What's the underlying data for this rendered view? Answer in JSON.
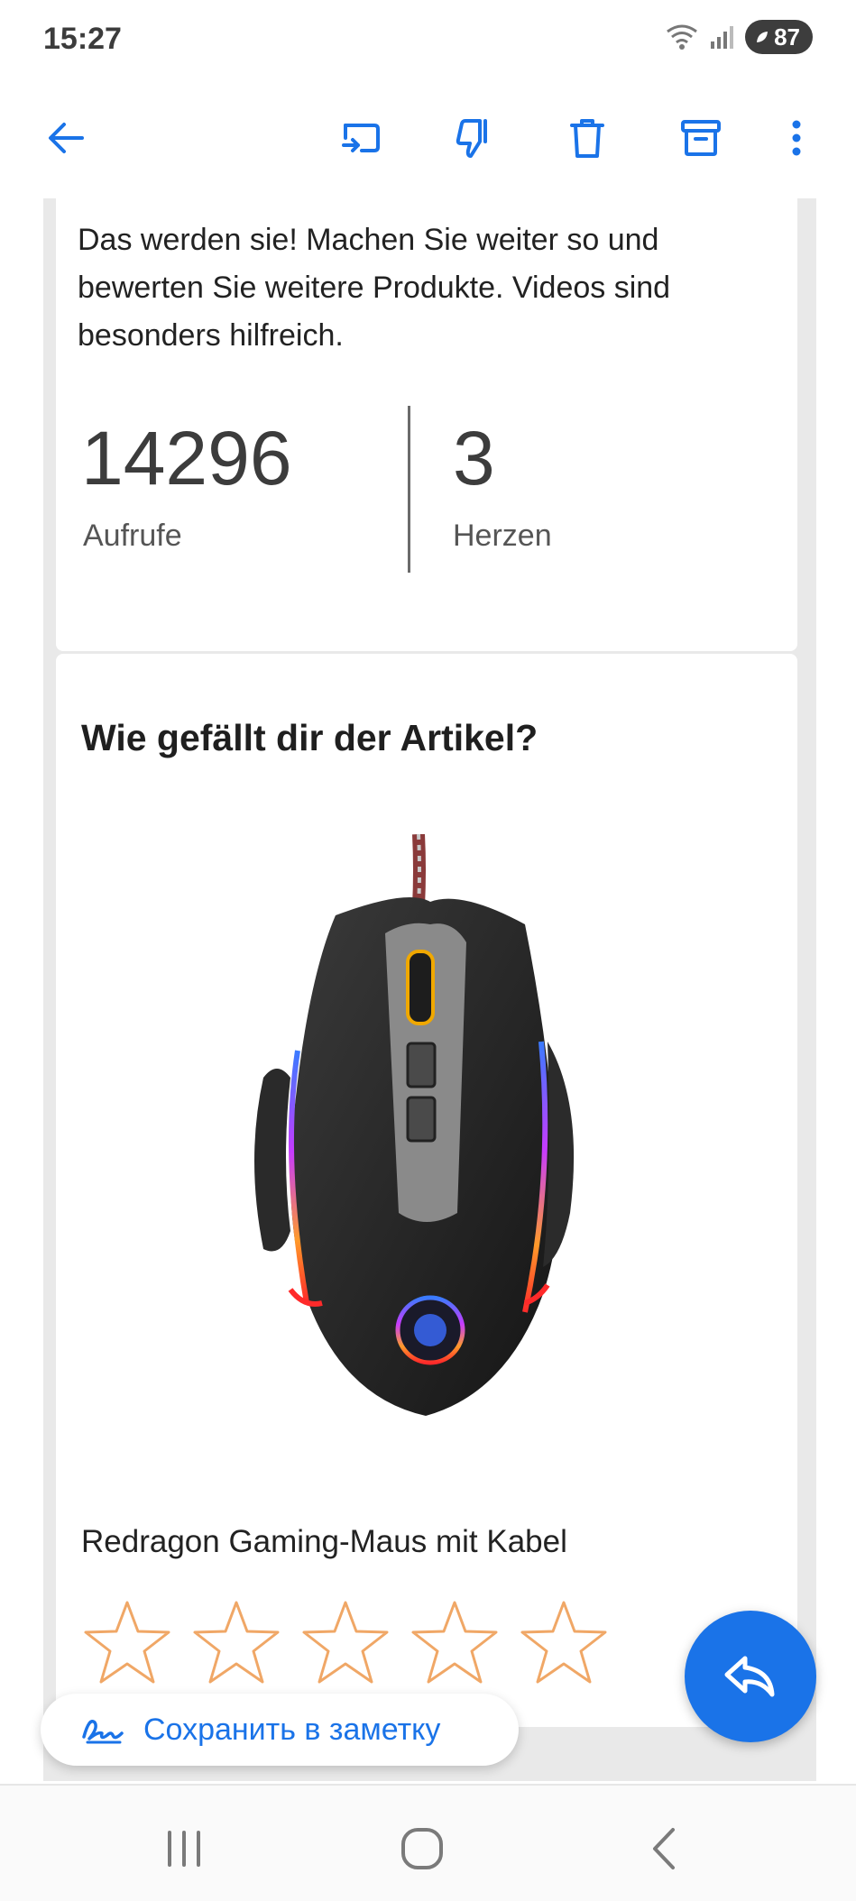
{
  "status_bar": {
    "time": "15:27",
    "battery": "87",
    "icons": [
      "wifi-icon",
      "signal-icon",
      "battery-icon"
    ]
  },
  "app_bar": {
    "icons": [
      "back-arrow-icon",
      "move-to-icon",
      "dislike-icon",
      "trash-icon",
      "archive-icon",
      "more-vert-icon"
    ],
    "accent_color": "#1a73e8"
  },
  "review_card": {
    "text": "Das werden sie! Machen Sie weiter so und bewerten Sie weitere Produkte. Videos sind besonders hilfreich.",
    "views_value": "14296",
    "views_label": "Aufrufe",
    "hearts_value": "3",
    "hearts_label": "Herzen"
  },
  "rating_card": {
    "title": "Wie gefällt dir der Artikel?",
    "product_name": "Redragon Gaming-Maus mit Kabel",
    "stars_count": 5,
    "star_color": "#f0a766"
  },
  "save_note": {
    "label": "Сохранить в заметку"
  },
  "nav_bar": {
    "icons": [
      "recent-apps-icon",
      "home-icon",
      "back-icon"
    ]
  }
}
